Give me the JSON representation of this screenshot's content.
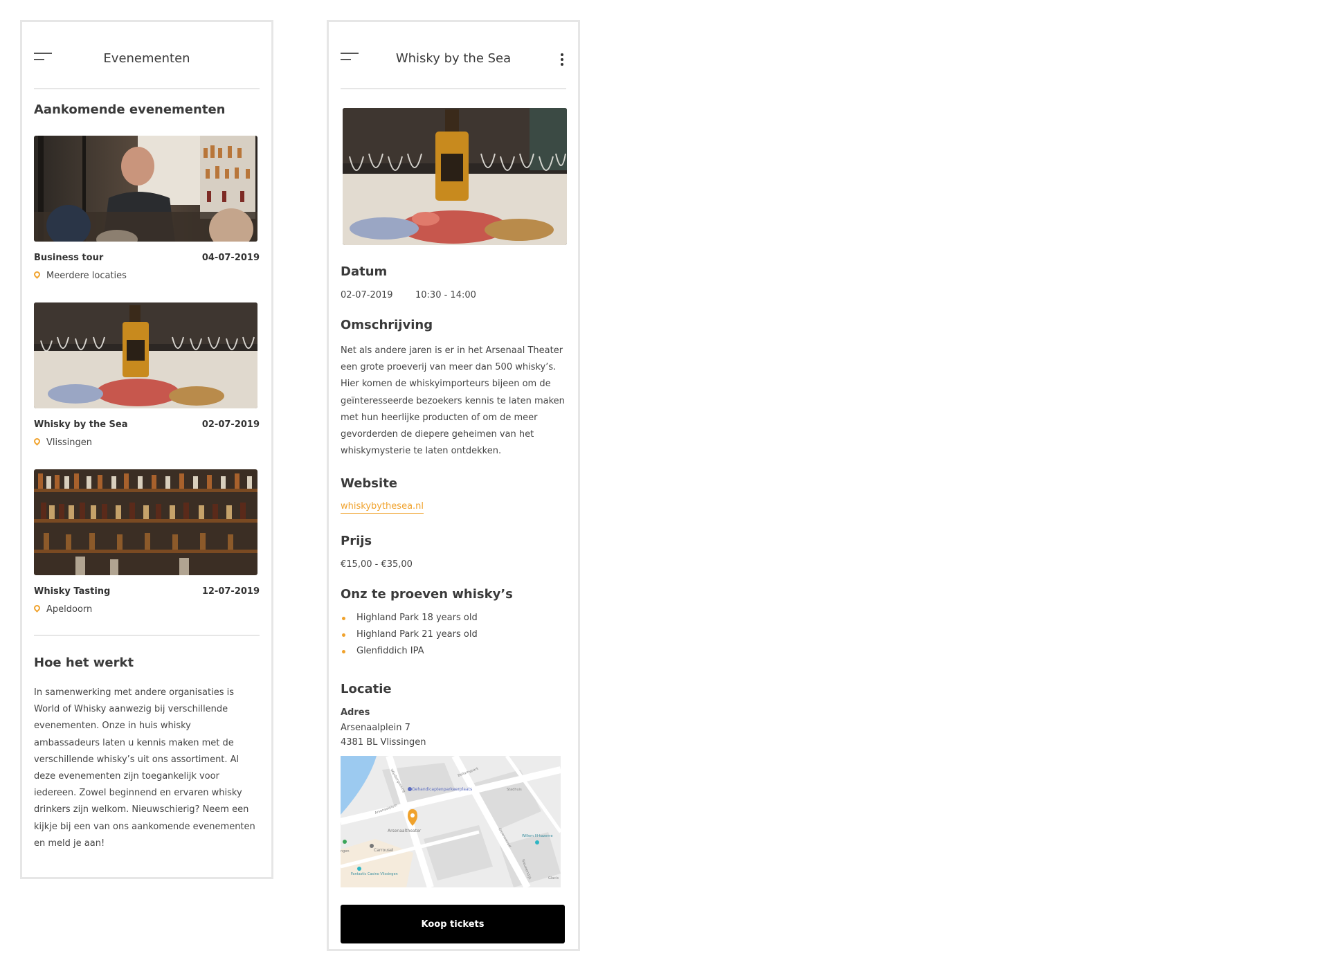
{
  "list_screen": {
    "header_title": "Evenementen",
    "section_title": "Aankomende evenementen",
    "events": [
      {
        "name": "Business tour",
        "date": "04-07-2019",
        "location": "Meerdere locaties"
      },
      {
        "name": "Whisky by the Sea",
        "date": "02-07-2019",
        "location": "Vlissingen"
      },
      {
        "name": "Whisky Tasting",
        "date": "12-07-2019",
        "location": "Apeldoorn"
      }
    ],
    "how_title": "Hoe het werkt",
    "how_text": "In samenwerking met andere organisaties is World of Whisky aanwezig bij verschillende evenementen. Onze in huis whisky ambassadeurs laten u kennis maken met de verschillende whisky’s uit ons assortiment. Al deze evenementen zijn toegankelijk voor iedereen. Zowel beginnend en ervaren whisky drinkers zijn welkom. Nieuwschierig? Neem een kijkje bij een van ons aankomende evenementen en meld je aan!"
  },
  "detail_screen": {
    "header_title": "Whisky by the Sea",
    "date_title": "Datum",
    "date": "02-07-2019",
    "time": "10:30 - 14:00",
    "description_title": "Omschrijving",
    "description": "Net als andere jaren is er in het Arsenaal Theater een grote proeverij van meer dan 500 whisky’s. Hier komen de whiskyimporteurs bijeen om de geïnteresseerde bezoekers kennis te laten maken met hun heerlijke producten of om de meer gevorderden de diepere geheimen van het whiskymysterie te laten ontdekken.",
    "website_title": "Website",
    "website_link": "whiskybythesea.nl",
    "price_title": "Prijs",
    "price": "€15,00 - €35,00",
    "whiskies_title": "Onz te proeven whisky’s",
    "whiskies": [
      "Highland Park 18 years old",
      "Highland Park 21 years old",
      "Glenfiddich IPA"
    ],
    "location_title": "Locatie",
    "address_label": "Adres",
    "address_line1": "Arsenaalplein 7",
    "address_line2": "4381 BL Vlissingen",
    "map_labels": {
      "parking": "Gehandicaptenparkeerplaats",
      "theater": "Arsenaaltheater",
      "carrousel": "Carrousel",
      "casino": "Fantastic Casino Vlissingen",
      "kazerne": "Willem III-kazerne",
      "street1": "Arsenaalplein",
      "street2": "Groenewoud",
      "street3": "Bellamypark",
      "street4": "Wijnbergseweg",
      "street5": "Stadhuis",
      "street6": "Nieuwendijk",
      "street7": "Glacis",
      "edge": "ngen"
    },
    "buy_button": "Koop tickets"
  },
  "colors": {
    "accent": "#f0a22c",
    "border": "#e6e6e6",
    "button": "#000000"
  }
}
